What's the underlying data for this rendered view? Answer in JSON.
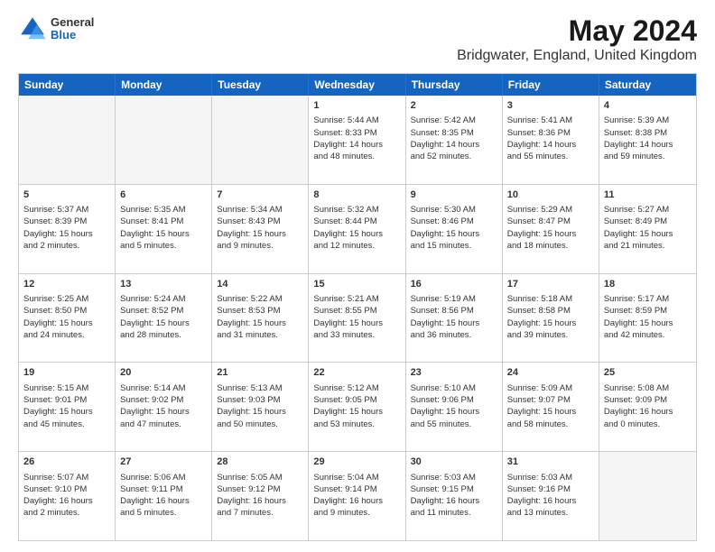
{
  "logo": {
    "general": "General",
    "blue": "Blue"
  },
  "title": "May 2024",
  "subtitle": "Bridgwater, England, United Kingdom",
  "header_days": [
    "Sunday",
    "Monday",
    "Tuesday",
    "Wednesday",
    "Thursday",
    "Friday",
    "Saturday"
  ],
  "weeks": [
    [
      {
        "day": "",
        "info": "",
        "empty": true
      },
      {
        "day": "",
        "info": "",
        "empty": true
      },
      {
        "day": "",
        "info": "",
        "empty": true
      },
      {
        "day": "1",
        "info": "Sunrise: 5:44 AM\nSunset: 8:33 PM\nDaylight: 14 hours\nand 48 minutes.",
        "empty": false
      },
      {
        "day": "2",
        "info": "Sunrise: 5:42 AM\nSunset: 8:35 PM\nDaylight: 14 hours\nand 52 minutes.",
        "empty": false
      },
      {
        "day": "3",
        "info": "Sunrise: 5:41 AM\nSunset: 8:36 PM\nDaylight: 14 hours\nand 55 minutes.",
        "empty": false
      },
      {
        "day": "4",
        "info": "Sunrise: 5:39 AM\nSunset: 8:38 PM\nDaylight: 14 hours\nand 59 minutes.",
        "empty": false
      }
    ],
    [
      {
        "day": "5",
        "info": "Sunrise: 5:37 AM\nSunset: 8:39 PM\nDaylight: 15 hours\nand 2 minutes.",
        "empty": false
      },
      {
        "day": "6",
        "info": "Sunrise: 5:35 AM\nSunset: 8:41 PM\nDaylight: 15 hours\nand 5 minutes.",
        "empty": false
      },
      {
        "day": "7",
        "info": "Sunrise: 5:34 AM\nSunset: 8:43 PM\nDaylight: 15 hours\nand 9 minutes.",
        "empty": false
      },
      {
        "day": "8",
        "info": "Sunrise: 5:32 AM\nSunset: 8:44 PM\nDaylight: 15 hours\nand 12 minutes.",
        "empty": false
      },
      {
        "day": "9",
        "info": "Sunrise: 5:30 AM\nSunset: 8:46 PM\nDaylight: 15 hours\nand 15 minutes.",
        "empty": false
      },
      {
        "day": "10",
        "info": "Sunrise: 5:29 AM\nSunset: 8:47 PM\nDaylight: 15 hours\nand 18 minutes.",
        "empty": false
      },
      {
        "day": "11",
        "info": "Sunrise: 5:27 AM\nSunset: 8:49 PM\nDaylight: 15 hours\nand 21 minutes.",
        "empty": false
      }
    ],
    [
      {
        "day": "12",
        "info": "Sunrise: 5:25 AM\nSunset: 8:50 PM\nDaylight: 15 hours\nand 24 minutes.",
        "empty": false
      },
      {
        "day": "13",
        "info": "Sunrise: 5:24 AM\nSunset: 8:52 PM\nDaylight: 15 hours\nand 28 minutes.",
        "empty": false
      },
      {
        "day": "14",
        "info": "Sunrise: 5:22 AM\nSunset: 8:53 PM\nDaylight: 15 hours\nand 31 minutes.",
        "empty": false
      },
      {
        "day": "15",
        "info": "Sunrise: 5:21 AM\nSunset: 8:55 PM\nDaylight: 15 hours\nand 33 minutes.",
        "empty": false
      },
      {
        "day": "16",
        "info": "Sunrise: 5:19 AM\nSunset: 8:56 PM\nDaylight: 15 hours\nand 36 minutes.",
        "empty": false
      },
      {
        "day": "17",
        "info": "Sunrise: 5:18 AM\nSunset: 8:58 PM\nDaylight: 15 hours\nand 39 minutes.",
        "empty": false
      },
      {
        "day": "18",
        "info": "Sunrise: 5:17 AM\nSunset: 8:59 PM\nDaylight: 15 hours\nand 42 minutes.",
        "empty": false
      }
    ],
    [
      {
        "day": "19",
        "info": "Sunrise: 5:15 AM\nSunset: 9:01 PM\nDaylight: 15 hours\nand 45 minutes.",
        "empty": false
      },
      {
        "day": "20",
        "info": "Sunrise: 5:14 AM\nSunset: 9:02 PM\nDaylight: 15 hours\nand 47 minutes.",
        "empty": false
      },
      {
        "day": "21",
        "info": "Sunrise: 5:13 AM\nSunset: 9:03 PM\nDaylight: 15 hours\nand 50 minutes.",
        "empty": false
      },
      {
        "day": "22",
        "info": "Sunrise: 5:12 AM\nSunset: 9:05 PM\nDaylight: 15 hours\nand 53 minutes.",
        "empty": false
      },
      {
        "day": "23",
        "info": "Sunrise: 5:10 AM\nSunset: 9:06 PM\nDaylight: 15 hours\nand 55 minutes.",
        "empty": false
      },
      {
        "day": "24",
        "info": "Sunrise: 5:09 AM\nSunset: 9:07 PM\nDaylight: 15 hours\nand 58 minutes.",
        "empty": false
      },
      {
        "day": "25",
        "info": "Sunrise: 5:08 AM\nSunset: 9:09 PM\nDaylight: 16 hours\nand 0 minutes.",
        "empty": false
      }
    ],
    [
      {
        "day": "26",
        "info": "Sunrise: 5:07 AM\nSunset: 9:10 PM\nDaylight: 16 hours\nand 2 minutes.",
        "empty": false
      },
      {
        "day": "27",
        "info": "Sunrise: 5:06 AM\nSunset: 9:11 PM\nDaylight: 16 hours\nand 5 minutes.",
        "empty": false
      },
      {
        "day": "28",
        "info": "Sunrise: 5:05 AM\nSunset: 9:12 PM\nDaylight: 16 hours\nand 7 minutes.",
        "empty": false
      },
      {
        "day": "29",
        "info": "Sunrise: 5:04 AM\nSunset: 9:14 PM\nDaylight: 16 hours\nand 9 minutes.",
        "empty": false
      },
      {
        "day": "30",
        "info": "Sunrise: 5:03 AM\nSunset: 9:15 PM\nDaylight: 16 hours\nand 11 minutes.",
        "empty": false
      },
      {
        "day": "31",
        "info": "Sunrise: 5:03 AM\nSunset: 9:16 PM\nDaylight: 16 hours\nand 13 minutes.",
        "empty": false
      },
      {
        "day": "",
        "info": "",
        "empty": true
      }
    ]
  ]
}
